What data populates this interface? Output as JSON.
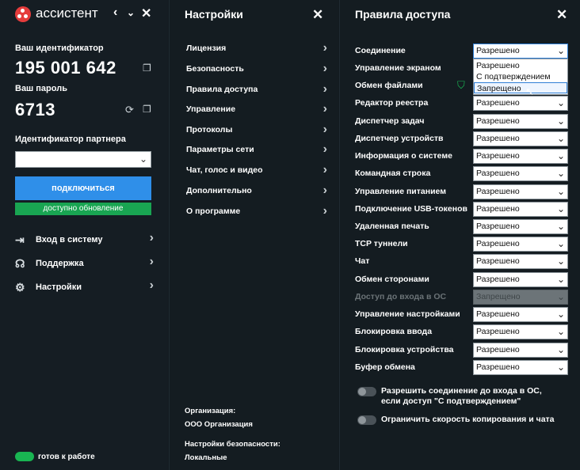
{
  "app": {
    "name": "ассистент"
  },
  "left": {
    "id_label": "Ваш идентификатор",
    "id_value": "195 001 642",
    "password_label": "Ваш пароль",
    "password_value": "6713",
    "partner_label": "Идентификатор партнера",
    "partner_value": "",
    "connect_label": "подключиться",
    "update_label": "доступно обновление",
    "nav": [
      {
        "label": "Вход в систему",
        "icon": "login-icon"
      },
      {
        "label": "Поддержка",
        "icon": "headset-icon"
      },
      {
        "label": "Настройки",
        "icon": "gears-icon"
      }
    ],
    "status_label": "готов к работе",
    "status_color": "#19b552",
    "connect_color": "#2f8fe9",
    "update_color": "#19a552"
  },
  "settings": {
    "title": "Настройки",
    "items": [
      "Лицензия",
      "Безопасность",
      "Правила доступа",
      "Управление",
      "Протоколы",
      "Параметры сети",
      "Чат, голос и видео",
      "Дополнительно",
      "О программе"
    ],
    "org_label": "Организация:",
    "org_value": "ООО Организация",
    "sec_label": "Настройки безопасности:",
    "sec_value": "Локальные"
  },
  "access": {
    "title": "Правила доступа",
    "rules": [
      {
        "label": "Соединение",
        "value": "Разрешено"
      },
      {
        "label": "Управление экраном",
        "value": ""
      },
      {
        "label": "Обмен файлами",
        "value": ""
      },
      {
        "label": "Редактор реестра",
        "value": "Разрешено"
      },
      {
        "label": "Диспетчер задач",
        "value": "Разрешено"
      },
      {
        "label": "Диспетчер устройств",
        "value": "Разрешено"
      },
      {
        "label": "Информация о системе",
        "value": "Разрешено"
      },
      {
        "label": "Командная строка",
        "value": "Разрешено"
      },
      {
        "label": "Управление питанием",
        "value": "Разрешено"
      },
      {
        "label": "Подключение USB-токенов",
        "value": "Разрешено"
      },
      {
        "label": "Удаленная печать",
        "value": "Разрешено"
      },
      {
        "label": "TCP туннели",
        "value": "Разрешено"
      },
      {
        "label": "Чат",
        "value": "Разрешено"
      },
      {
        "label": "Обмен сторонами",
        "value": "Разрешено"
      },
      {
        "label": "Доступ до входа в ОС",
        "value": "Запрещено"
      },
      {
        "label": "Управление настройками",
        "value": "Разрешено"
      },
      {
        "label": "Блокировка ввода",
        "value": "Разрешено"
      },
      {
        "label": "Блокировка устройства",
        "value": "Разрешено"
      },
      {
        "label": "Буфер обмена",
        "value": "Разрешено"
      }
    ],
    "dropdown_options": [
      "Разрешено",
      "С подтверждением",
      "Запрещено"
    ],
    "dropdown_highlighted": "Запрещено",
    "options": [
      {
        "label": "Разрешить соединение до входа в ОС, если доступ \"С подтверждением\""
      },
      {
        "label": "Ограничить скорость копирования и чата"
      }
    ]
  }
}
